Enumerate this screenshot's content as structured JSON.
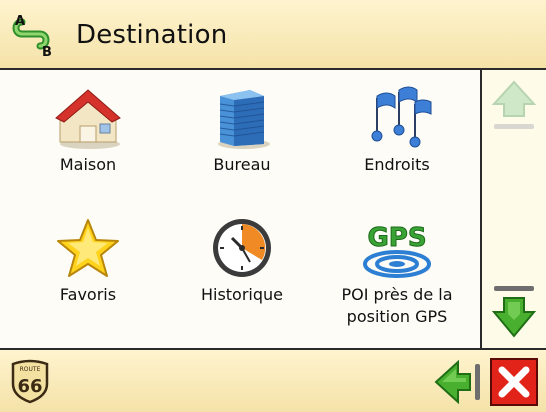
{
  "header": {
    "title": "Destination",
    "icon": "route-ab-icon"
  },
  "menu": {
    "items": [
      {
        "label": "Maison",
        "icon": "house-icon"
      },
      {
        "label": "Bureau",
        "icon": "office-building-icon"
      },
      {
        "label": "Endroits",
        "icon": "flags-icon"
      },
      {
        "label": "Favoris",
        "icon": "star-icon"
      },
      {
        "label": "Historique",
        "icon": "clock-icon"
      },
      {
        "label_line1": "POI près de la",
        "label_line2": "position GPS",
        "icon": "gps-icon"
      }
    ]
  },
  "scroll": {
    "up_icon": "arrow-up-icon",
    "down_icon": "arrow-down-icon",
    "up_enabled": false,
    "down_enabled": true
  },
  "footer": {
    "logo_top": "ROUTE",
    "logo_number": "66",
    "back_icon": "back-arrow-icon",
    "close_icon": "close-icon"
  },
  "colors": {
    "background": "#fffbe9",
    "header": "#f4e2a8",
    "accent_green": "#3aa335",
    "close_red": "#e2231a"
  }
}
